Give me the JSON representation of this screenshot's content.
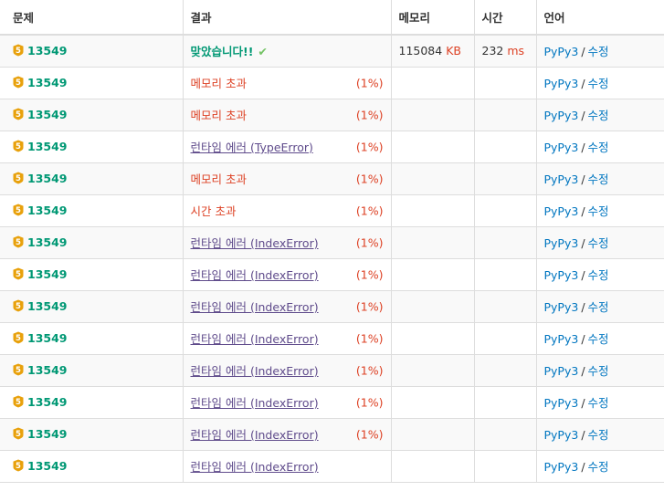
{
  "colors": {
    "problem": "#009874",
    "accepted": "#009874",
    "error": "#dd4124",
    "runtime_error": "#5f4b8b",
    "link": "#0076c0",
    "tier_badge": "#e8a10c"
  },
  "headers": {
    "problem": "문제",
    "result": "결과",
    "memory": "메모리",
    "time": "시간",
    "language": "언어"
  },
  "rows": [
    {
      "problem": "13549",
      "tier_icon": "silver-5-tier-icon",
      "result": "맞았습니다!!",
      "result_type": "ac",
      "check": "✔",
      "percent": "",
      "memory": "115084",
      "memory_unit": "KB",
      "time": "232",
      "time_unit": "ms",
      "lang": "PyPy3",
      "edit": "수정"
    },
    {
      "problem": "13549",
      "tier_icon": "silver-5-tier-icon",
      "result": "메모리 초과",
      "result_type": "mle",
      "percent": "(1%)",
      "memory": "",
      "memory_unit": "",
      "time": "",
      "time_unit": "",
      "lang": "PyPy3",
      "edit": "수정"
    },
    {
      "problem": "13549",
      "tier_icon": "silver-5-tier-icon",
      "result": "메모리 초과",
      "result_type": "mle",
      "percent": "(1%)",
      "memory": "",
      "memory_unit": "",
      "time": "",
      "time_unit": "",
      "lang": "PyPy3",
      "edit": "수정"
    },
    {
      "problem": "13549",
      "tier_icon": "silver-5-tier-icon",
      "result": "런타임 에러 (TypeError)",
      "result_type": "rte",
      "percent": "(1%)",
      "memory": "",
      "memory_unit": "",
      "time": "",
      "time_unit": "",
      "lang": "PyPy3",
      "edit": "수정"
    },
    {
      "problem": "13549",
      "tier_icon": "silver-5-tier-icon",
      "result": "메모리 초과",
      "result_type": "mle",
      "percent": "(1%)",
      "memory": "",
      "memory_unit": "",
      "time": "",
      "time_unit": "",
      "lang": "PyPy3",
      "edit": "수정"
    },
    {
      "problem": "13549",
      "tier_icon": "silver-5-tier-icon",
      "result": "시간 초과",
      "result_type": "tle",
      "percent": "(1%)",
      "memory": "",
      "memory_unit": "",
      "time": "",
      "time_unit": "",
      "lang": "PyPy3",
      "edit": "수정"
    },
    {
      "problem": "13549",
      "tier_icon": "silver-5-tier-icon",
      "result": "런타임 에러 (IndexError)",
      "result_type": "rte",
      "percent": "(1%)",
      "memory": "",
      "memory_unit": "",
      "time": "",
      "time_unit": "",
      "lang": "PyPy3",
      "edit": "수정"
    },
    {
      "problem": "13549",
      "tier_icon": "silver-5-tier-icon",
      "result": "런타임 에러 (IndexError)",
      "result_type": "rte",
      "percent": "(1%)",
      "memory": "",
      "memory_unit": "",
      "time": "",
      "time_unit": "",
      "lang": "PyPy3",
      "edit": "수정"
    },
    {
      "problem": "13549",
      "tier_icon": "silver-5-tier-icon",
      "result": "런타임 에러 (IndexError)",
      "result_type": "rte",
      "percent": "(1%)",
      "memory": "",
      "memory_unit": "",
      "time": "",
      "time_unit": "",
      "lang": "PyPy3",
      "edit": "수정"
    },
    {
      "problem": "13549",
      "tier_icon": "silver-5-tier-icon",
      "result": "런타임 에러 (IndexError)",
      "result_type": "rte",
      "percent": "(1%)",
      "memory": "",
      "memory_unit": "",
      "time": "",
      "time_unit": "",
      "lang": "PyPy3",
      "edit": "수정"
    },
    {
      "problem": "13549",
      "tier_icon": "silver-5-tier-icon",
      "result": "런타임 에러 (IndexError)",
      "result_type": "rte",
      "percent": "(1%)",
      "memory": "",
      "memory_unit": "",
      "time": "",
      "time_unit": "",
      "lang": "PyPy3",
      "edit": "수정"
    },
    {
      "problem": "13549",
      "tier_icon": "silver-5-tier-icon",
      "result": "런타임 에러 (IndexError)",
      "result_type": "rte",
      "percent": "(1%)",
      "memory": "",
      "memory_unit": "",
      "time": "",
      "time_unit": "",
      "lang": "PyPy3",
      "edit": "수정"
    },
    {
      "problem": "13549",
      "tier_icon": "silver-5-tier-icon",
      "result": "런타임 에러 (IndexError)",
      "result_type": "rte",
      "percent": "(1%)",
      "memory": "",
      "memory_unit": "",
      "time": "",
      "time_unit": "",
      "lang": "PyPy3",
      "edit": "수정"
    },
    {
      "problem": "13549",
      "tier_icon": "silver-5-tier-icon",
      "result": "런타임 에러 (IndexError)",
      "result_type": "rte",
      "percent": "",
      "memory": "",
      "memory_unit": "",
      "time": "",
      "time_unit": "",
      "lang": "PyPy3",
      "edit": "수정"
    }
  ]
}
